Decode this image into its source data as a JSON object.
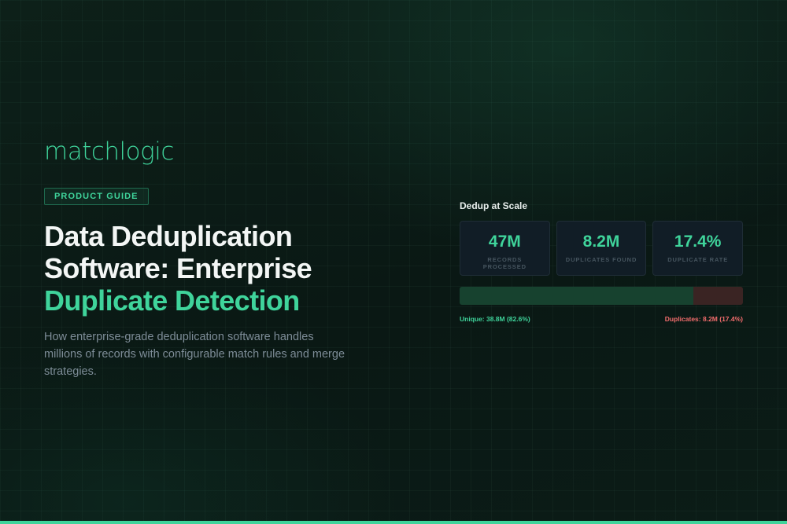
{
  "brand": {
    "logo_text": "matchlogic"
  },
  "hero": {
    "badge": "PRODUCT GUIDE",
    "title_line1": "Data Deduplication",
    "title_line2": "Software: Enterprise",
    "title_accent": "Duplicate Detection",
    "description": "How enterprise-grade deduplication software handles millions of records with configurable match rules and merge strategies."
  },
  "panel": {
    "title": "Dedup at Scale",
    "stats": [
      {
        "value": "47M",
        "label": "RECORDS PROCESSED"
      },
      {
        "value": "8.2M",
        "label": "DUPLICATES FOUND"
      },
      {
        "value": "17.4%",
        "label": "DUPLICATE RATE"
      }
    ],
    "bar": {
      "unique_fraction": 0.826,
      "duplicate_fraction": 0.174,
      "unique_color": "#17422f",
      "duplicate_color": "#3a2423"
    },
    "legend": {
      "unique": "Unique: 38.8M (82.6%)",
      "duplicates": "Duplicates: 8.2M (17.4%)"
    }
  },
  "colors": {
    "accent": "#3fd49b",
    "background": "#0b1a16",
    "danger": "#f26d6d"
  }
}
